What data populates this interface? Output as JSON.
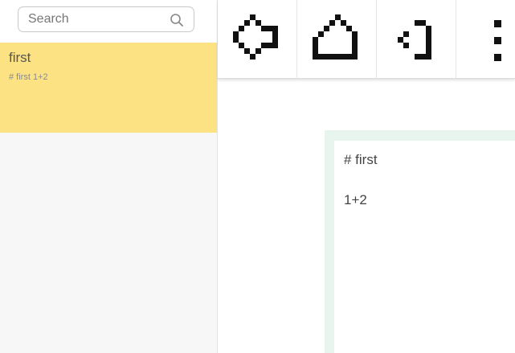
{
  "search": {
    "placeholder": "Search"
  },
  "notes": [
    {
      "title": "first",
      "preview": "# first 1+2"
    }
  ],
  "toolbar": {
    "buttons": [
      {
        "icon": "pixel-right-arrow-icon"
      },
      {
        "icon": "pixel-house-icon"
      },
      {
        "icon": "pixel-left-bracket-icon"
      },
      {
        "icon": "pixel-more-dots-icon"
      }
    ]
  },
  "editor": {
    "lines": [
      "# first",
      "1+2"
    ]
  },
  "colors": {
    "selected_note": "#fde284",
    "editor_frame": "#e8f4ee",
    "sidebar_bg": "#f7f7f7"
  }
}
